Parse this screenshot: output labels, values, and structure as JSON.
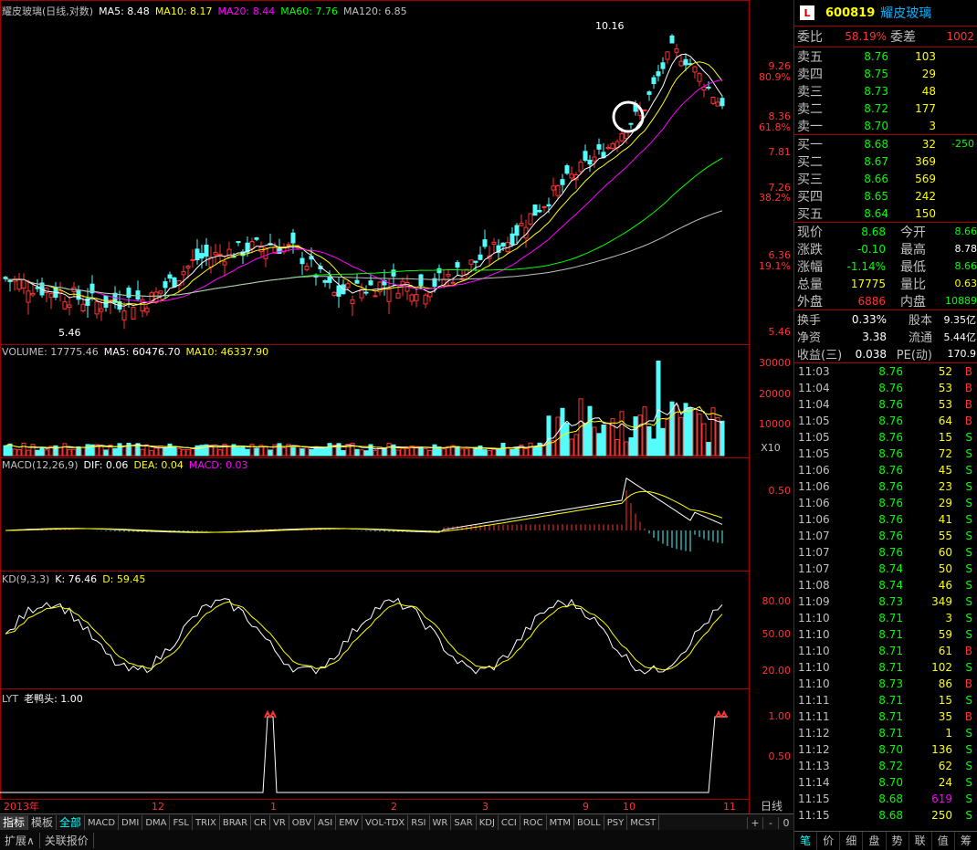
{
  "main_header": {
    "title": "耀皮玻璃(日线,对数)",
    "ma5": "MA5: 8.48",
    "ma10": "MA10: 8.17",
    "ma20": "MA20: 8.44",
    "ma60": "MA60: 7.76",
    "ma120": "MA120: 6.85"
  },
  "volume_header": {
    "title": "VOLUME: 17775.46",
    "ma5": "MA5: 60476.70",
    "ma10": "MA10: 46337.90"
  },
  "macd_header": {
    "title": "MACD(12,26,9)",
    "dif": "DIF: 0.06",
    "dea": "DEA: 0.04",
    "macd": "MACD: 0.03"
  },
  "kd_header": {
    "title": "KD(9,3,3)",
    "k": "K: 76.46",
    "d": "D: 59.45"
  },
  "lyt_header": {
    "title": "LYT",
    "val": "老鸭头: 1.00"
  },
  "colors": {
    "up": "#ff3232",
    "down": "#54fcfc",
    "ma5": "#ffffff",
    "ma10": "#ffff00",
    "ma20": "#ff00ff",
    "ma60": "#00ff00",
    "ma120": "#c0c0c0",
    "grid": "#a00000"
  },
  "chart_data": [
    {
      "type": "candlestick",
      "title": "耀皮玻璃(日线,对数)",
      "y_axis_labels": [
        "9.26",
        "8.36",
        "7.81",
        "7.26",
        "6.36",
        "5.46"
      ],
      "pct_labels": [
        "80.9%",
        "61.8%",
        "38.2%",
        "19.1%"
      ],
      "annotations": [
        "10.16",
        "5.46"
      ],
      "x_labels": [
        "2013年",
        "12",
        "1",
        "2",
        "3",
        "9",
        "10",
        "11"
      ],
      "period_label": "日线",
      "series": [
        {
          "name": "MA5",
          "latest": 8.48
        },
        {
          "name": "MA10",
          "latest": 8.17
        },
        {
          "name": "MA20",
          "latest": 8.44
        },
        {
          "name": "MA60",
          "latest": 7.76
        },
        {
          "name": "MA120",
          "latest": 6.85
        }
      ]
    },
    {
      "type": "bar",
      "title": "VOLUME",
      "y_axis_labels": [
        "30000",
        "20000",
        "10000"
      ],
      "unit_label": "X10",
      "latest": {
        "VOLUME": 17775.46,
        "MA5": 60476.7,
        "MA10": 46337.9
      }
    },
    {
      "type": "line",
      "title": "MACD(12,26,9)",
      "y_axis_labels": [
        "0.50"
      ],
      "latest": {
        "DIF": 0.06,
        "DEA": 0.04,
        "MACD": 0.03
      }
    },
    {
      "type": "line",
      "title": "KD(9,3,3)",
      "y_axis_labels": [
        "80.00",
        "50.00",
        "20.00"
      ],
      "latest": {
        "K": 76.46,
        "D": 59.45
      }
    },
    {
      "type": "line",
      "title": "LYT",
      "y_axis_labels": [
        "1.00",
        "0.50"
      ],
      "latest": {
        "老鸭头": 1.0
      }
    }
  ],
  "quote": {
    "code": "600819",
    "name": "耀皮玻璃",
    "ratio_label": "委比",
    "ratio": "58.19%",
    "diff_label": "委差",
    "diff": "1002",
    "asks": [
      {
        "label": "卖五",
        "price": "8.76",
        "vol": "103"
      },
      {
        "label": "卖四",
        "price": "8.75",
        "vol": "29"
      },
      {
        "label": "卖三",
        "price": "8.73",
        "vol": "48"
      },
      {
        "label": "卖二",
        "price": "8.72",
        "vol": "177"
      },
      {
        "label": "卖一",
        "price": "8.70",
        "vol": "3"
      }
    ],
    "bids": [
      {
        "label": "买一",
        "price": "8.68",
        "vol": "32",
        "chg": "-250"
      },
      {
        "label": "买二",
        "price": "8.67",
        "vol": "369",
        "chg": ""
      },
      {
        "label": "买三",
        "price": "8.66",
        "vol": "569",
        "chg": ""
      },
      {
        "label": "买四",
        "price": "8.65",
        "vol": "242",
        "chg": ""
      },
      {
        "label": "买五",
        "price": "8.64",
        "vol": "150",
        "chg": ""
      }
    ],
    "stats": [
      {
        "l1": "现价",
        "v1": "8.68",
        "c1": "#00ff00",
        "l2": "今开",
        "v2": "8.66",
        "c2": "#00ff00"
      },
      {
        "l1": "涨跌",
        "v1": "-0.10",
        "c1": "#00ff00",
        "l2": "最高",
        "v2": "8.78",
        "c2": "#ffffff"
      },
      {
        "l1": "涨幅",
        "v1": "-1.14%",
        "c1": "#00ff00",
        "l2": "最低",
        "v2": "8.66",
        "c2": "#00ff00"
      },
      {
        "l1": "总量",
        "v1": "17775",
        "c1": "#ffff00",
        "l2": "量比",
        "v2": "0.63",
        "c2": "#ffff00"
      },
      {
        "l1": "外盘",
        "v1": "6886",
        "c1": "#ff3232",
        "l2": "内盘",
        "v2": "10889",
        "c2": "#00ff00"
      }
    ],
    "info": [
      {
        "l1": "换手",
        "v1": "0.33%",
        "l2": "股本",
        "v2": "9.35亿"
      },
      {
        "l1": "净资",
        "v1": "3.38",
        "l2": "流通",
        "v2": "5.44亿"
      },
      {
        "l1": "收益(三)",
        "v1": "0.038",
        "l2": "PE(动)",
        "v2": "170.9"
      }
    ],
    "ticks": [
      {
        "time": "11:03",
        "price": "8.76",
        "vol": "52",
        "bs": "B"
      },
      {
        "time": "11:04",
        "price": "8.76",
        "vol": "53",
        "bs": "B"
      },
      {
        "time": "11:04",
        "price": "8.76",
        "vol": "53",
        "bs": "B"
      },
      {
        "time": "11:05",
        "price": "8.76",
        "vol": "64",
        "bs": "B"
      },
      {
        "time": "11:05",
        "price": "8.76",
        "vol": "15",
        "bs": "S"
      },
      {
        "time": "11:05",
        "price": "8.76",
        "vol": "72",
        "bs": "S"
      },
      {
        "time": "11:06",
        "price": "8.76",
        "vol": "45",
        "bs": "S"
      },
      {
        "time": "11:06",
        "price": "8.76",
        "vol": "23",
        "bs": "S"
      },
      {
        "time": "11:06",
        "price": "8.76",
        "vol": "29",
        "bs": "S"
      },
      {
        "time": "11:06",
        "price": "8.76",
        "vol": "41",
        "bs": "S"
      },
      {
        "time": "11:07",
        "price": "8.76",
        "vol": "55",
        "bs": "S"
      },
      {
        "time": "11:07",
        "price": "8.76",
        "vol": "60",
        "bs": "S"
      },
      {
        "time": "11:07",
        "price": "8.74",
        "vol": "50",
        "bs": "S"
      },
      {
        "time": "11:08",
        "price": "8.74",
        "vol": "46",
        "bs": "S"
      },
      {
        "time": "11:09",
        "price": "8.73",
        "vol": "349",
        "bs": "S"
      },
      {
        "time": "11:10",
        "price": "8.71",
        "vol": "3",
        "bs": "S"
      },
      {
        "time": "11:10",
        "price": "8.71",
        "vol": "59",
        "bs": "S"
      },
      {
        "time": "11:10",
        "price": "8.71",
        "vol": "61",
        "bs": "B"
      },
      {
        "time": "11:10",
        "price": "8.71",
        "vol": "102",
        "bs": "S"
      },
      {
        "time": "11:10",
        "price": "8.73",
        "vol": "86",
        "bs": "B"
      },
      {
        "time": "11:11",
        "price": "8.71",
        "vol": "15",
        "bs": "S"
      },
      {
        "time": "11:11",
        "price": "8.71",
        "vol": "35",
        "bs": "B"
      },
      {
        "time": "11:12",
        "price": "8.71",
        "vol": "1",
        "bs": "S"
      },
      {
        "time": "11:12",
        "price": "8.70",
        "vol": "136",
        "bs": "S"
      },
      {
        "time": "11:13",
        "price": "8.72",
        "vol": "62",
        "bs": "S"
      },
      {
        "time": "11:14",
        "price": "8.70",
        "vol": "24",
        "bs": "S"
      },
      {
        "time": "11:15",
        "price": "8.68",
        "vol": "619",
        "bs": "S"
      },
      {
        "time": "11:15",
        "price": "8.68",
        "vol": "250",
        "bs": "S"
      }
    ],
    "tabs": [
      "笔",
      "价",
      "细",
      "盘",
      "势",
      "联",
      "值",
      "筹"
    ]
  },
  "indicator_tabs": [
    "指标",
    "模板",
    "全部",
    "MACD",
    "DMI",
    "DMA",
    "FSL",
    "TRIX",
    "BRAR",
    "CR",
    "VR",
    "OBV",
    "ASI",
    "EMV",
    "VOL-TDX",
    "RSI",
    "WR",
    "SAR",
    "KDJ",
    "CCI",
    "ROC",
    "MTM",
    "BOLL",
    "PSY",
    "MCST"
  ],
  "tab_controls": [
    "+",
    "-",
    "0"
  ],
  "ext_bar": [
    "扩展∧",
    "关联报价"
  ]
}
